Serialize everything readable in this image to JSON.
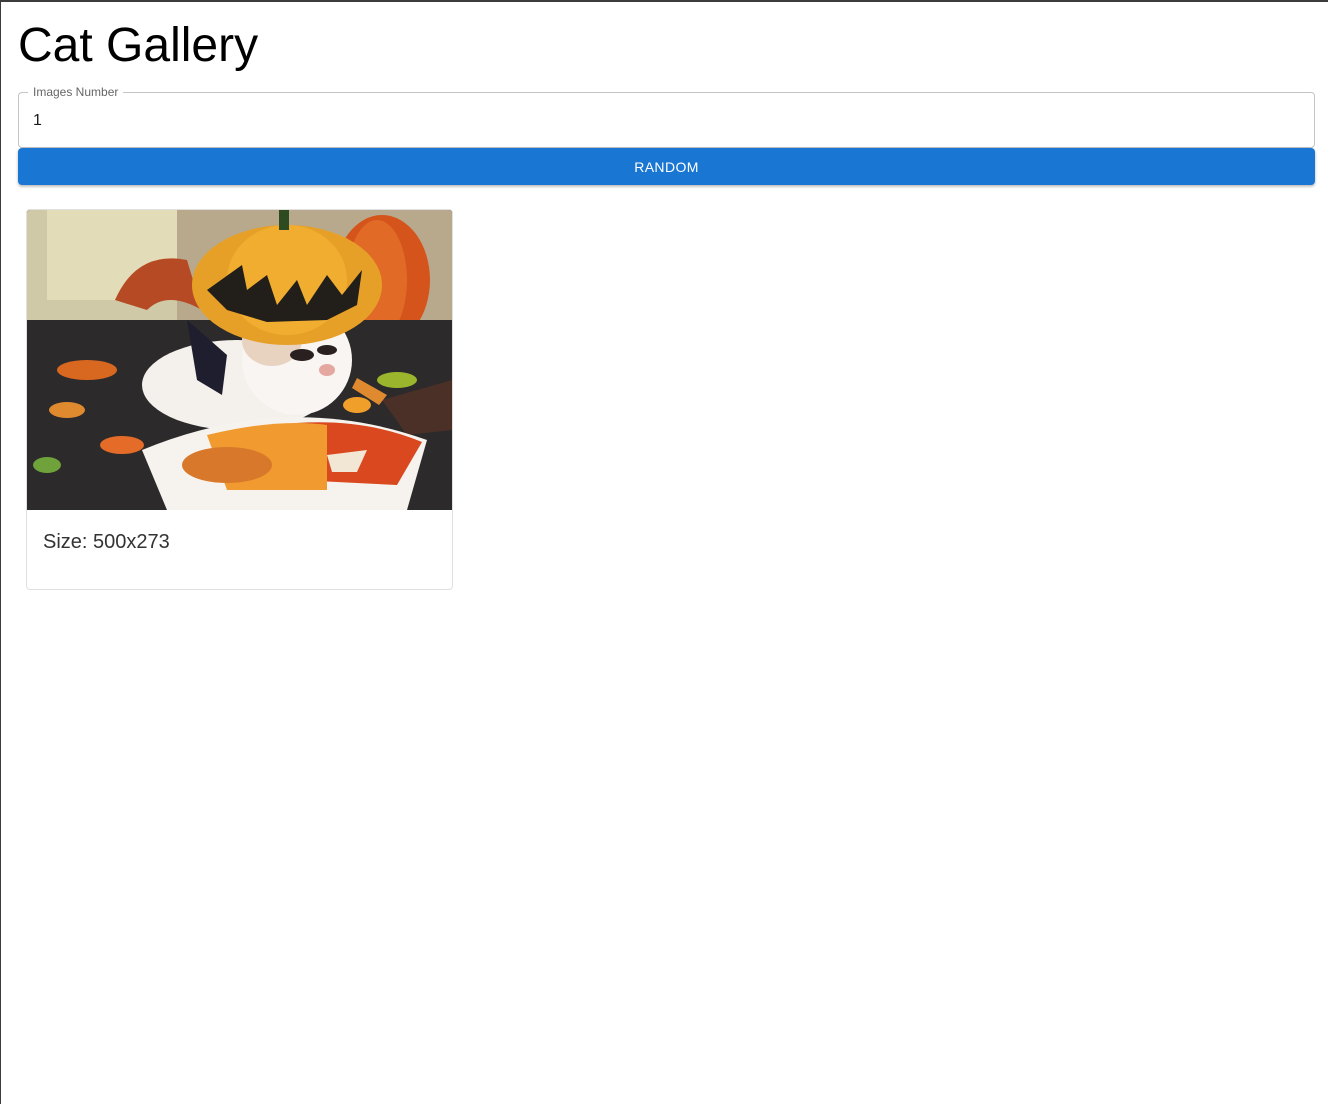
{
  "page": {
    "title": "Cat Gallery"
  },
  "form": {
    "images_number_label": "Images Number",
    "images_number_value": "1",
    "random_button_label": "RANDOM"
  },
  "gallery": {
    "cards": [
      {
        "image_icon": "cat-photo",
        "caption": "Size: 500x273"
      }
    ]
  },
  "colors": {
    "accent": "#1976d2",
    "button_text": "#ffffff",
    "border": "#c4c4c4"
  }
}
